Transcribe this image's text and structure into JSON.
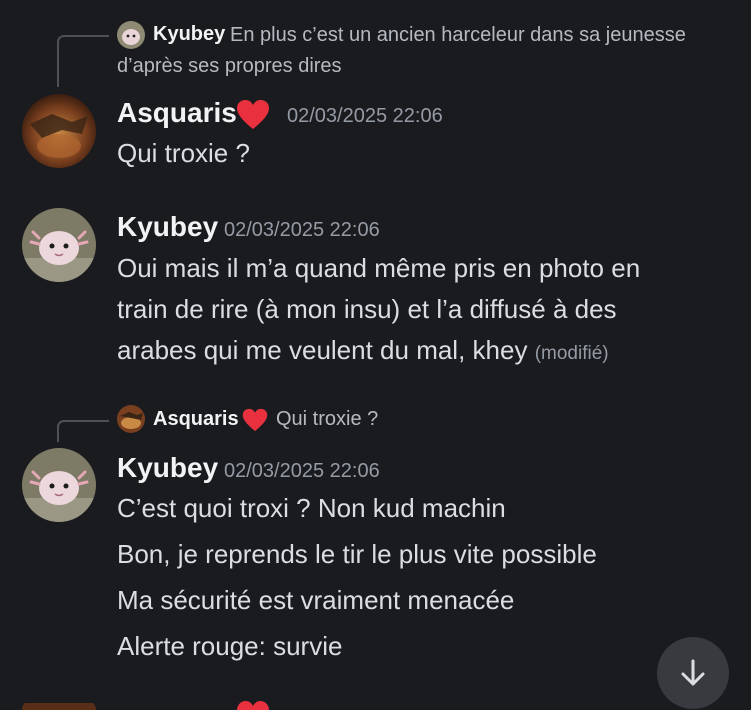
{
  "reply1": {
    "author": "Kyubey",
    "text": "En plus c’est un ancien harceleur dans sa jeunesse d’après ses propres dires"
  },
  "msg1": {
    "author": "Asquaris",
    "timestamp": "02/03/2025 22:06",
    "lines": [
      "Qui troxie ?"
    ]
  },
  "msg2": {
    "author": "Kyubey",
    "timestamp": "02/03/2025 22:06",
    "line1": "Oui mais il m’a quand même pris en photo en",
    "line2": "train de rire (à  mon insu) et l’a diffusé à des",
    "line3": "arabes qui me veulent du mal, khey",
    "edited": "(modifié)"
  },
  "reply2": {
    "author": "Asquaris",
    "text": "Qui troxie ?"
  },
  "msg3": {
    "author": "Kyubey",
    "timestamp": "02/03/2025 22:06",
    "lines": [
      "C’est quoi troxi ? Non kud machin",
      "Bon, je reprends le tir le plus vite possible",
      "Ma sécurité est vraiment menacée",
      "Alerte rouge: survie"
    ]
  },
  "colors": {
    "background": "#1a1b1f",
    "heart": "#e8303f",
    "username": "#f2f3f5",
    "timestamp": "#949ba4"
  },
  "icons": {
    "scroll": "arrow-down-icon",
    "heart": "red-heart-icon"
  }
}
